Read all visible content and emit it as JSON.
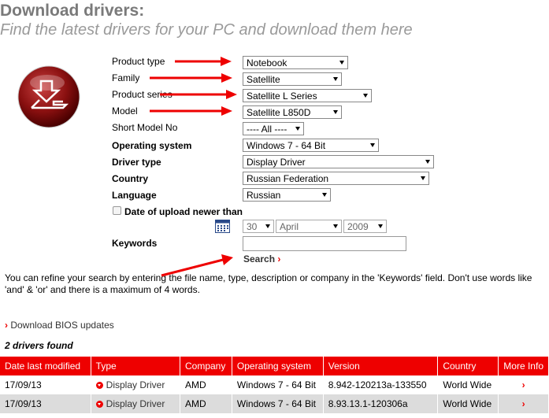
{
  "header": {
    "title": "Download drivers:",
    "subtitle": "Find the latest drivers for your PC and download them here"
  },
  "form": {
    "product_type": {
      "label": "Product type",
      "value": "Notebook"
    },
    "family": {
      "label": "Family",
      "value": "Satellite"
    },
    "product_series": {
      "label": "Product series",
      "value": "Satellite L Series"
    },
    "model": {
      "label": "Model",
      "value": "Satellite L850D"
    },
    "short_model": {
      "label": "Short Model No",
      "value": "---- All ----"
    },
    "os": {
      "label": "Operating system",
      "value": "Windows 7 - 64 Bit"
    },
    "driver_type": {
      "label": "Driver type",
      "value": "Display Driver"
    },
    "country": {
      "label": "Country",
      "value": "Russian Federation"
    },
    "language": {
      "label": "Language",
      "value": "Russian"
    },
    "date_upload": {
      "label": "Date of upload newer than",
      "day": "30",
      "month": "April",
      "year": "2009"
    },
    "keywords": {
      "label": "Keywords",
      "value": ""
    },
    "search_label": "Search"
  },
  "help_text": "You can refine your search by entering the file name, type, description or company in the 'Keywords' field. Don't use words like 'and' & 'or' and there is a maximum of 4 words.",
  "bios_link": "Download BIOS updates",
  "found_text": "2 drivers found",
  "table": {
    "headers": [
      "Date last modified",
      "Type",
      "Company",
      "Operating system",
      "Version",
      "Country",
      "More Info"
    ],
    "rows": [
      {
        "date": "17/09/13",
        "type": "Display Driver",
        "company": "AMD",
        "os": "Windows 7 - 64 Bit",
        "version": "8.942-120213a-133550",
        "country": "World Wide"
      },
      {
        "date": "17/09/13",
        "type": "Display Driver",
        "company": "AMD",
        "os": "Windows 7 - 64 Bit",
        "version": "8.93.13.1-120306a",
        "country": "World Wide"
      }
    ]
  },
  "colors": {
    "accent": "#e00000",
    "header_gray": "#7a7a7a",
    "row_alt": "#dcdcdc"
  },
  "icons": {
    "logo": "download-laptop-icon",
    "calendar": "calendar-icon",
    "chevron": "chevron-right-icon",
    "download": "download-icon"
  }
}
